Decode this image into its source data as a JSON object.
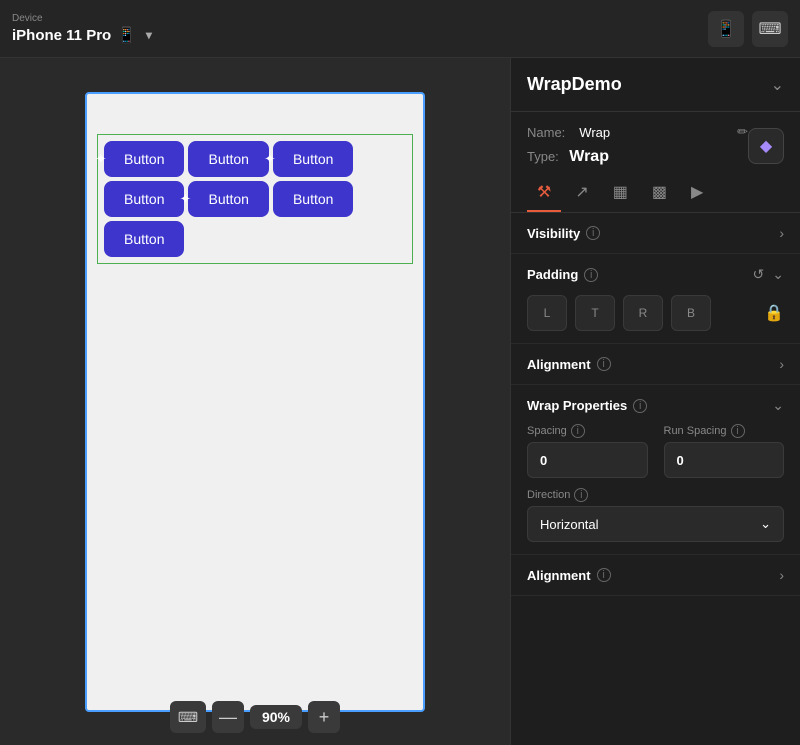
{
  "topbar": {
    "device_label": "Device",
    "device_name": "iPhone 11 Pro",
    "chevron": "▾",
    "phone_icon": "📱"
  },
  "canvas": {
    "zoom_label": "90%",
    "zoom_minus": "—",
    "zoom_plus": "+",
    "buttons": [
      "Button",
      "Button",
      "Button",
      "Button",
      "Button",
      "Button",
      "Button"
    ]
  },
  "panel": {
    "title": "WrapDemo",
    "name_label": "Name:",
    "name_value": "Wrap",
    "type_label": "Type:",
    "type_value": "Wrap",
    "tabs": [
      {
        "label": "⚒",
        "active": true
      },
      {
        "label": "↗",
        "active": false
      },
      {
        "label": "▦",
        "active": false
      },
      {
        "label": "▩",
        "active": false
      },
      {
        "label": "▶",
        "active": false
      }
    ],
    "sections": {
      "visibility": {
        "title": "Visibility",
        "info": "i"
      },
      "padding": {
        "title": "Padding",
        "info": "i",
        "inputs": [
          "L",
          "T",
          "R",
          "B"
        ]
      },
      "alignment": {
        "title": "Alignment",
        "info": "i"
      },
      "wrap_properties": {
        "title": "Wrap Properties",
        "info": "i",
        "spacing_label": "Spacing",
        "spacing_value": "0",
        "run_spacing_label": "Run Spacing",
        "run_spacing_value": "0",
        "direction_label": "Direction",
        "direction_value": "Horizontal",
        "alignment_label": "Alignment",
        "alignment_info": "i"
      }
    }
  }
}
